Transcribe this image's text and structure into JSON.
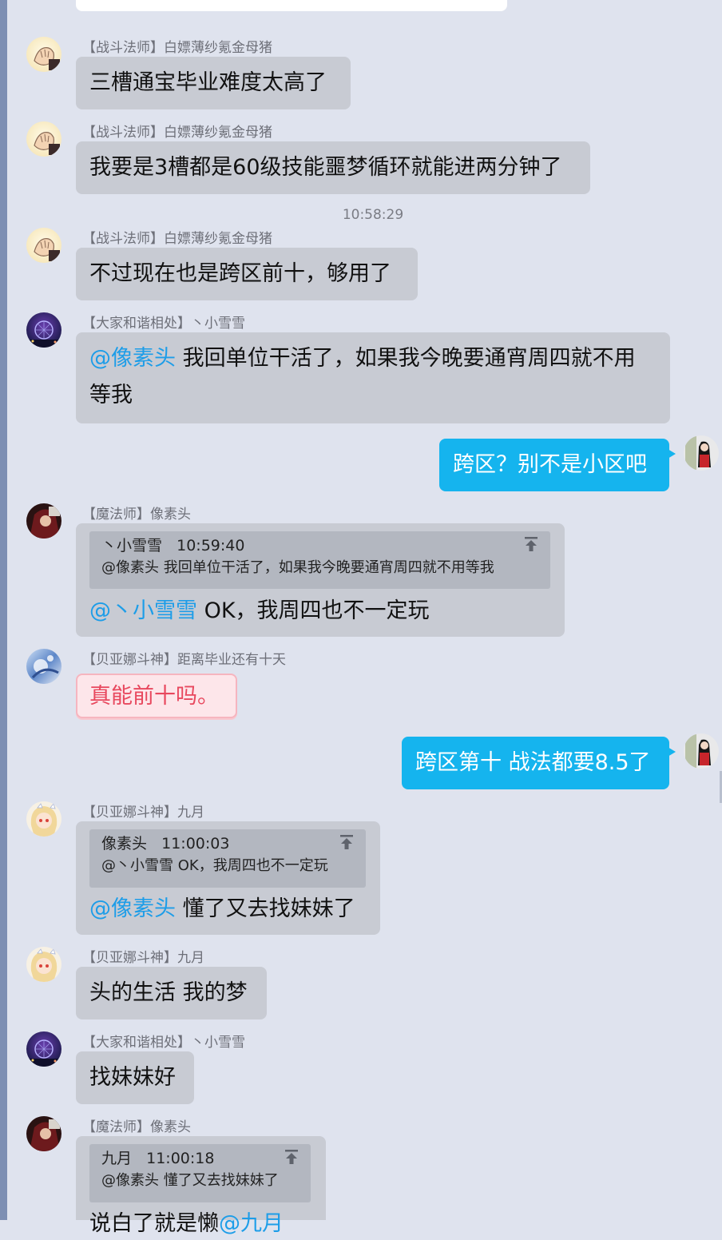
{
  "colors": {
    "background": "#dfe3ee",
    "bubble_other": "#c8cbd3",
    "bubble_me": "#15b4ee",
    "mention": "#1d9de8",
    "pink_bubble_text": "#e8485e"
  },
  "messages": [
    {
      "sender": "【战斗法师】白嫖薄纱氪金母猪",
      "text": "三槽通宝毕业难度太高了",
      "avatar": "hand-avatar-icon"
    },
    {
      "sender": "【战斗法师】白嫖薄纱氪金母猪",
      "text": "我要是3槽都是60级技能噩梦循环就能进两分钟了",
      "avatar": "hand-avatar-icon"
    },
    {
      "time": "10:58:29"
    },
    {
      "sender": "【战斗法师】白嫖薄纱氪金母猪",
      "text": "不过现在也是跨区前十，够用了",
      "avatar": "hand-avatar-icon"
    },
    {
      "sender": "【大家和谐相处】丶小雪雪",
      "mention": "@像素头",
      "text": " 我回单位干活了，如果我今晚要通宵周四就不用",
      "text2": "等我",
      "avatar": "ferris-wheel-avatar-icon"
    },
    {
      "self": true,
      "text": "跨区？别不是小区吧",
      "avatar": "self-avatar-icon"
    },
    {
      "sender": "【魔法师】像素头",
      "quote_head": "丶小雪雪   10:59:40",
      "quote_body": "@像素头 我回单位干活了，如果我今晚要通宵周四就不用等我",
      "mention": "@丶小雪雪",
      "text": " OK，我周四也不一定玩",
      "avatar": "dark-avatar-icon"
    },
    {
      "sender": "【贝亚娜斗神】距离毕业还有十天",
      "text": "真能前十吗。",
      "avatar": "blue-art-avatar-icon"
    },
    {
      "self": true,
      "text": "跨区第十 战法都要8.5了",
      "avatar": "self-avatar-icon"
    },
    {
      "sender": "【贝亚娜斗神】九月",
      "quote_head": "像素头   11:00:03",
      "quote_body": "@丶小雪雪 OK，我周四也不一定玩",
      "mention": "@像素头",
      "text": " 懂了又去找妹妹了",
      "avatar": "anime-girl-avatar-icon"
    },
    {
      "sender": "【贝亚娜斗神】九月",
      "text": "头的生活 我的梦",
      "avatar": "anime-girl-avatar-icon"
    },
    {
      "sender": "【大家和谐相处】丶小雪雪",
      "text": "找妹妹好",
      "avatar": "ferris-wheel-avatar-icon"
    },
    {
      "sender": "【魔法师】像素头",
      "quote_head": "九月   11:00:18",
      "quote_body": "@像素头 懂了又去找妹妹了",
      "text": "说白了就是懒",
      "mention": "@九月",
      "avatar": "dark-avatar-icon"
    }
  ]
}
